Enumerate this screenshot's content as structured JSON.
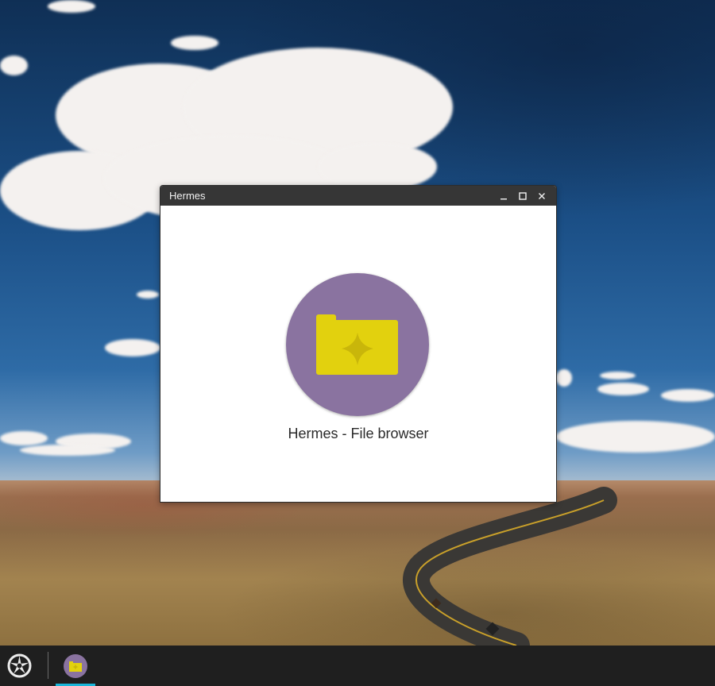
{
  "window": {
    "title": "Hermes",
    "controls": [
      "minimize-icon",
      "maximize-icon",
      "close-icon"
    ]
  },
  "app": {
    "name": "Hermes - File browser",
    "icon": "folder-icon",
    "colors": {
      "circle": "#8a73a0",
      "folder": "#e2d10e"
    }
  },
  "taskbar": {
    "launcher_icon": "launcher-icon",
    "items": [
      {
        "icon": "folder-icon",
        "active": true
      }
    ],
    "indicator_color": "#1ab6d9"
  }
}
